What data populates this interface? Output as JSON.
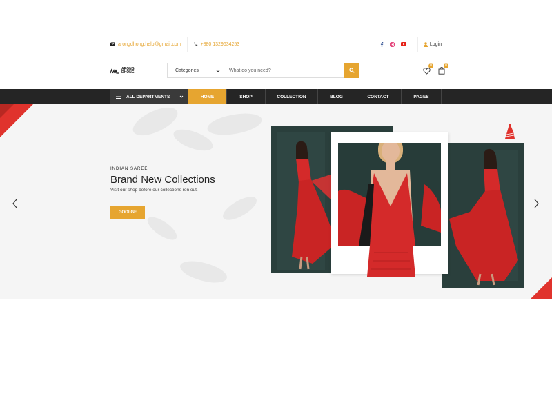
{
  "topbar": {
    "email": "arongdhong.help@gmail.com",
    "phone": "+880 1329634253",
    "login": "Login"
  },
  "header": {
    "logo_line1": "ARONG",
    "logo_line2": "DHONG",
    "category_select": "Categories",
    "search_placeholder": "What do you need?",
    "wishlist_count": "0",
    "cart_count": "0"
  },
  "nav": {
    "departments": "ALL DEPARTMENTS",
    "items": [
      "HOME",
      "SHOP",
      "COLLECTION",
      "BLOG",
      "CONTACT",
      "PAGES"
    ],
    "active_index": 0
  },
  "hero": {
    "eyebrow": "INDIAN SAREE",
    "title": "Brand New Collections",
    "subtitle": "Visit our shop before our collections ron out.",
    "button": "GOOLGE"
  },
  "colors": {
    "accent": "#e6a530",
    "nav_bg": "#252525",
    "red": "#e0332d"
  },
  "icons": {
    "email": "envelope-icon",
    "phone": "phone-icon",
    "facebook": "facebook-icon",
    "instagram": "instagram-icon",
    "youtube": "youtube-icon",
    "login": "user-icon",
    "search": "search-icon",
    "wishlist": "heart-icon",
    "cart": "shopping-bag-icon"
  }
}
